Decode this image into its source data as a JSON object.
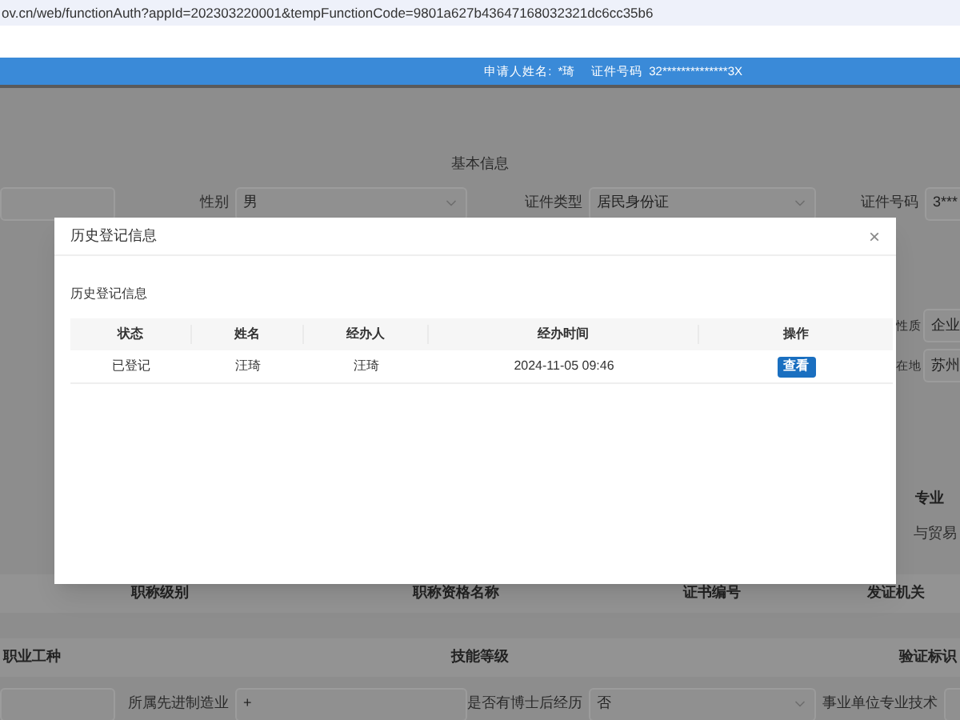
{
  "address_bar": {
    "url": "ov.cn/web/functionAuth?appId=202303220001&tempFunctionCode=9801a627b43647168032321dc6cc35b6"
  },
  "header": {
    "applicant_label": "申请人姓名:",
    "applicant_name": "*琦",
    "id_label": "证件号码",
    "id_value": "32**************3X"
  },
  "form": {
    "section_title": "基本信息",
    "row_1": [
      {
        "label": "性别",
        "value": "男",
        "kind": "select"
      },
      {
        "label": "证件类型",
        "value": "居民身份证",
        "kind": "select"
      },
      {
        "label": "证件号码",
        "value": "3***",
        "kind": "input"
      }
    ],
    "right_fields": [
      {
        "label": "性质",
        "value": "企业"
      },
      {
        "label": "在地",
        "value": "苏州"
      }
    ],
    "major_heading": "专业",
    "major_value": "与贸易",
    "certificate_columns": [
      "职称级别",
      "职称资格名称",
      "证书编号",
      "发证机关"
    ],
    "skill_columns": [
      "职业工种",
      "技能等级",
      "验证标识"
    ],
    "bottom_fields": [
      {
        "label": "所属先进制造业",
        "value": "+",
        "kind": "input"
      },
      {
        "label": "是否有博士后经历",
        "value": "否",
        "kind": "select"
      },
      {
        "label": "事业单位专业技术",
        "kind": "input"
      }
    ]
  },
  "dialog": {
    "title": "历史登记信息",
    "close": "×",
    "section": "历史登记信息",
    "columns": [
      "状态",
      "姓名",
      "经办人",
      "经办时间",
      "操作"
    ],
    "rows": [
      {
        "status": "已登记",
        "name": "汪琦",
        "handler": "汪琦",
        "time": "2024-11-05 09:46",
        "action": "查看"
      }
    ]
  }
}
